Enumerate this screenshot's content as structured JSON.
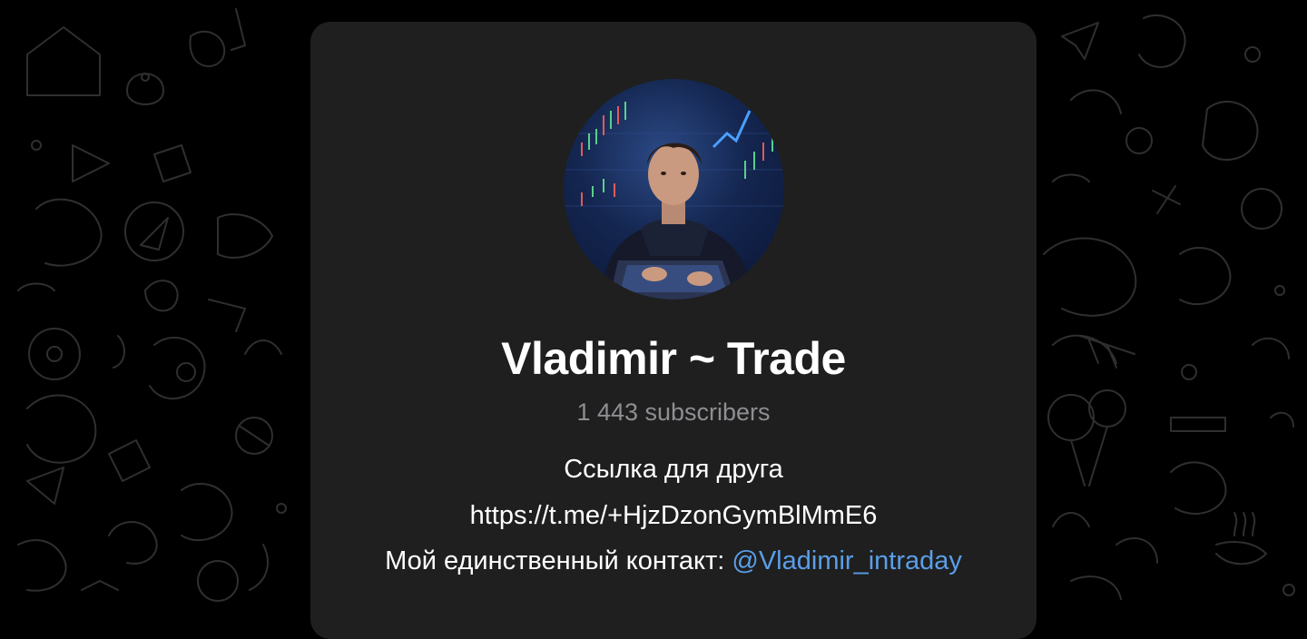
{
  "channel": {
    "name": "Vladimir ~ Trade",
    "subscribers": "1 443 subscribers",
    "avatar_icon": "channel-avatar-trader-at-laptop"
  },
  "description": {
    "line1": "Ссылка для друга",
    "line2": "https://t.me/+HjzDzonGymBlMmE6",
    "line3_prefix": "Мой единственный контакт: ",
    "mention": "@Vladimir_intraday"
  },
  "colors": {
    "background": "#000000",
    "card": "#1f1f1f",
    "title": "#ffffff",
    "muted": "#8e8e93",
    "link": "#5a9ee8"
  }
}
